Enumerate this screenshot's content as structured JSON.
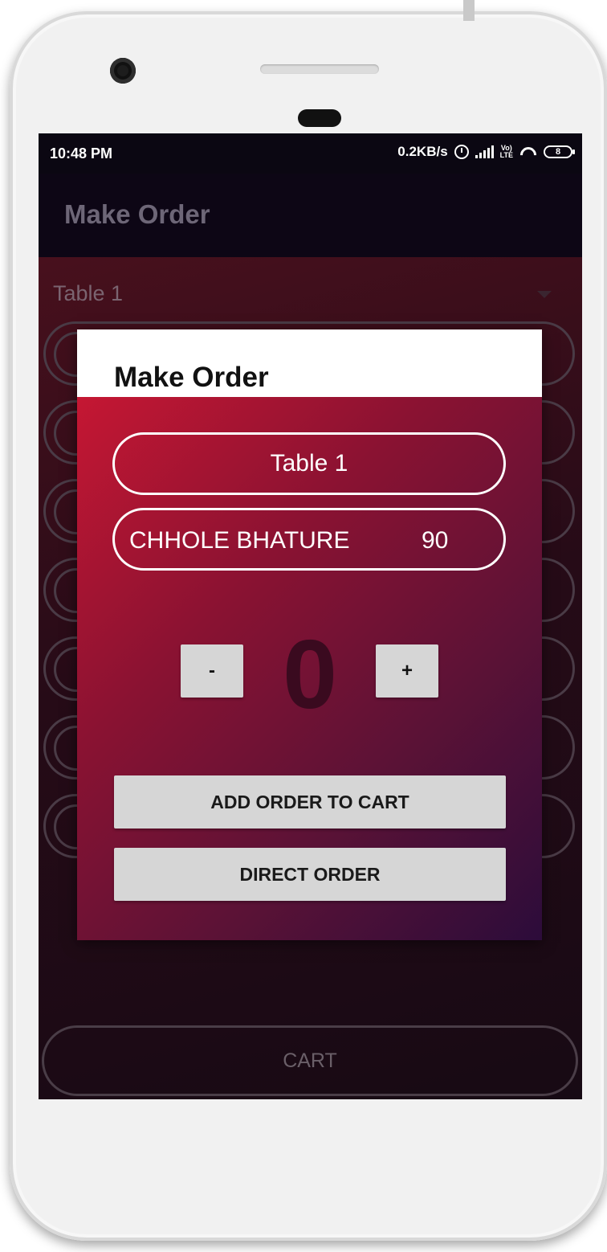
{
  "status_bar": {
    "time": "10:48 PM",
    "net_speed": "0.2KB/s",
    "volte_label_top": "Vo)",
    "volte_label_bottom": "LTE",
    "battery_level": "8",
    "icons": [
      "alarm-icon",
      "signal-icon",
      "volte-icon",
      "wifi-icon",
      "battery-icon"
    ]
  },
  "toolbar": {
    "title": "Make Order"
  },
  "background_screen": {
    "table_spinner_value": "Table 1",
    "cart_label": "CART"
  },
  "dialog": {
    "title": "Make Order",
    "table": "Table 1",
    "item": {
      "name": "CHHOLE BHATURE",
      "price": "90"
    },
    "quantity": {
      "minus_label": "-",
      "value": "0",
      "plus_label": "+"
    },
    "add_to_cart_label": "ADD ORDER TO CART",
    "direct_order_label": "DIRECT ORDER"
  },
  "colors": {
    "dialog_gradient_start": "#c51733",
    "dialog_gradient_end": "#2c0c3a",
    "button_gray": "#d6d6d6",
    "toolbar_dark": "#0d0615"
  }
}
